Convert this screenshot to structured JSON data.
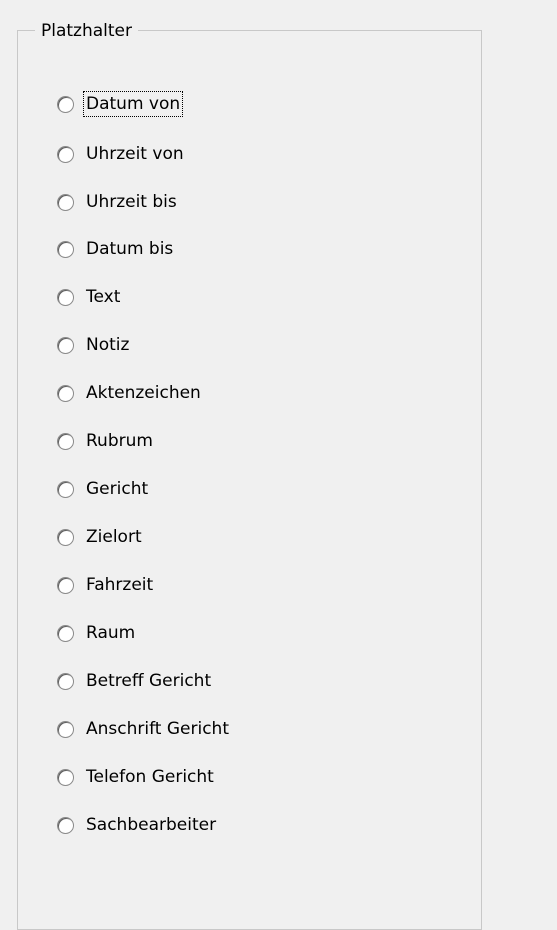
{
  "group": {
    "title": "Platzhalter"
  },
  "radio_options": [
    {
      "label": "Datum von",
      "checked": false,
      "focused": true
    },
    {
      "label": "Uhrzeit von",
      "checked": false
    },
    {
      "label": "Uhrzeit bis",
      "checked": false
    },
    {
      "label": "Datum bis",
      "checked": false
    },
    {
      "label": "Text",
      "checked": false
    },
    {
      "label": "Notiz",
      "checked": false
    },
    {
      "label": "Aktenzeichen",
      "checked": false
    },
    {
      "label": "Rubrum",
      "checked": false
    },
    {
      "label": "Gericht",
      "checked": false
    },
    {
      "label": "Zielort",
      "checked": false
    },
    {
      "label": "Fahrzeit",
      "checked": false
    },
    {
      "label": "Raum",
      "checked": false
    },
    {
      "label": "Betreff Gericht",
      "checked": false
    },
    {
      "label": "Anschrift Gericht",
      "checked": false
    },
    {
      "label": "Telefon Gericht",
      "checked": false
    },
    {
      "label": "Sachbearbeiter",
      "checked": false
    }
  ]
}
